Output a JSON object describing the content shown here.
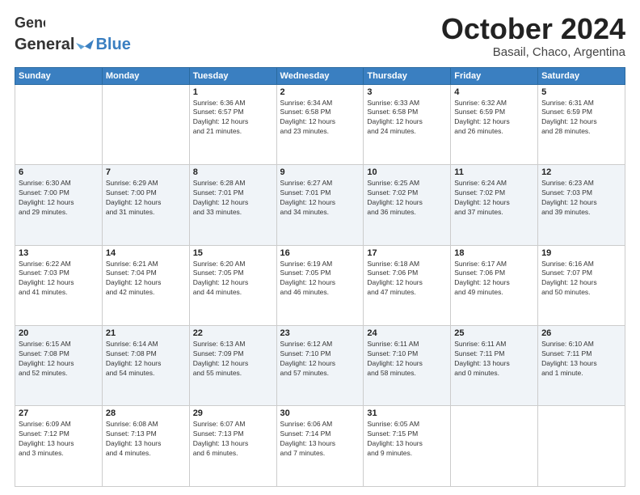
{
  "header": {
    "logo_general": "General",
    "logo_blue": "Blue",
    "month": "October 2024",
    "location": "Basail, Chaco, Argentina"
  },
  "days_of_week": [
    "Sunday",
    "Monday",
    "Tuesday",
    "Wednesday",
    "Thursday",
    "Friday",
    "Saturday"
  ],
  "weeks": [
    [
      {
        "day": "",
        "info": ""
      },
      {
        "day": "",
        "info": ""
      },
      {
        "day": "1",
        "info": "Sunrise: 6:36 AM\nSunset: 6:57 PM\nDaylight: 12 hours\nand 21 minutes."
      },
      {
        "day": "2",
        "info": "Sunrise: 6:34 AM\nSunset: 6:58 PM\nDaylight: 12 hours\nand 23 minutes."
      },
      {
        "day": "3",
        "info": "Sunrise: 6:33 AM\nSunset: 6:58 PM\nDaylight: 12 hours\nand 24 minutes."
      },
      {
        "day": "4",
        "info": "Sunrise: 6:32 AM\nSunset: 6:59 PM\nDaylight: 12 hours\nand 26 minutes."
      },
      {
        "day": "5",
        "info": "Sunrise: 6:31 AM\nSunset: 6:59 PM\nDaylight: 12 hours\nand 28 minutes."
      }
    ],
    [
      {
        "day": "6",
        "info": "Sunrise: 6:30 AM\nSunset: 7:00 PM\nDaylight: 12 hours\nand 29 minutes."
      },
      {
        "day": "7",
        "info": "Sunrise: 6:29 AM\nSunset: 7:00 PM\nDaylight: 12 hours\nand 31 minutes."
      },
      {
        "day": "8",
        "info": "Sunrise: 6:28 AM\nSunset: 7:01 PM\nDaylight: 12 hours\nand 33 minutes."
      },
      {
        "day": "9",
        "info": "Sunrise: 6:27 AM\nSunset: 7:01 PM\nDaylight: 12 hours\nand 34 minutes."
      },
      {
        "day": "10",
        "info": "Sunrise: 6:25 AM\nSunset: 7:02 PM\nDaylight: 12 hours\nand 36 minutes."
      },
      {
        "day": "11",
        "info": "Sunrise: 6:24 AM\nSunset: 7:02 PM\nDaylight: 12 hours\nand 37 minutes."
      },
      {
        "day": "12",
        "info": "Sunrise: 6:23 AM\nSunset: 7:03 PM\nDaylight: 12 hours\nand 39 minutes."
      }
    ],
    [
      {
        "day": "13",
        "info": "Sunrise: 6:22 AM\nSunset: 7:03 PM\nDaylight: 12 hours\nand 41 minutes."
      },
      {
        "day": "14",
        "info": "Sunrise: 6:21 AM\nSunset: 7:04 PM\nDaylight: 12 hours\nand 42 minutes."
      },
      {
        "day": "15",
        "info": "Sunrise: 6:20 AM\nSunset: 7:05 PM\nDaylight: 12 hours\nand 44 minutes."
      },
      {
        "day": "16",
        "info": "Sunrise: 6:19 AM\nSunset: 7:05 PM\nDaylight: 12 hours\nand 46 minutes."
      },
      {
        "day": "17",
        "info": "Sunrise: 6:18 AM\nSunset: 7:06 PM\nDaylight: 12 hours\nand 47 minutes."
      },
      {
        "day": "18",
        "info": "Sunrise: 6:17 AM\nSunset: 7:06 PM\nDaylight: 12 hours\nand 49 minutes."
      },
      {
        "day": "19",
        "info": "Sunrise: 6:16 AM\nSunset: 7:07 PM\nDaylight: 12 hours\nand 50 minutes."
      }
    ],
    [
      {
        "day": "20",
        "info": "Sunrise: 6:15 AM\nSunset: 7:08 PM\nDaylight: 12 hours\nand 52 minutes."
      },
      {
        "day": "21",
        "info": "Sunrise: 6:14 AM\nSunset: 7:08 PM\nDaylight: 12 hours\nand 54 minutes."
      },
      {
        "day": "22",
        "info": "Sunrise: 6:13 AM\nSunset: 7:09 PM\nDaylight: 12 hours\nand 55 minutes."
      },
      {
        "day": "23",
        "info": "Sunrise: 6:12 AM\nSunset: 7:10 PM\nDaylight: 12 hours\nand 57 minutes."
      },
      {
        "day": "24",
        "info": "Sunrise: 6:11 AM\nSunset: 7:10 PM\nDaylight: 12 hours\nand 58 minutes."
      },
      {
        "day": "25",
        "info": "Sunrise: 6:11 AM\nSunset: 7:11 PM\nDaylight: 13 hours\nand 0 minutes."
      },
      {
        "day": "26",
        "info": "Sunrise: 6:10 AM\nSunset: 7:11 PM\nDaylight: 13 hours\nand 1 minute."
      }
    ],
    [
      {
        "day": "27",
        "info": "Sunrise: 6:09 AM\nSunset: 7:12 PM\nDaylight: 13 hours\nand 3 minutes."
      },
      {
        "day": "28",
        "info": "Sunrise: 6:08 AM\nSunset: 7:13 PM\nDaylight: 13 hours\nand 4 minutes."
      },
      {
        "day": "29",
        "info": "Sunrise: 6:07 AM\nSunset: 7:13 PM\nDaylight: 13 hours\nand 6 minutes."
      },
      {
        "day": "30",
        "info": "Sunrise: 6:06 AM\nSunset: 7:14 PM\nDaylight: 13 hours\nand 7 minutes."
      },
      {
        "day": "31",
        "info": "Sunrise: 6:05 AM\nSunset: 7:15 PM\nDaylight: 13 hours\nand 9 minutes."
      },
      {
        "day": "",
        "info": ""
      },
      {
        "day": "",
        "info": ""
      }
    ]
  ]
}
